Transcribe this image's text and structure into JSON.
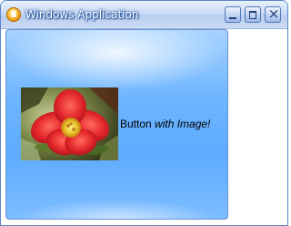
{
  "window": {
    "title": "Windows Application",
    "controls": {
      "minimize_icon": "minimize-icon",
      "maximize_icon": "maximize-icon",
      "close_icon": "close-icon",
      "close_glyph": "×"
    }
  },
  "button": {
    "label_plain": "Button ",
    "label_italic": "with Image!",
    "image": "red-tulip-flower-photo"
  },
  "colors": {
    "button_blue": "#5eabff",
    "title_text": "#ffffff",
    "frame_border": "#5a86c9"
  }
}
